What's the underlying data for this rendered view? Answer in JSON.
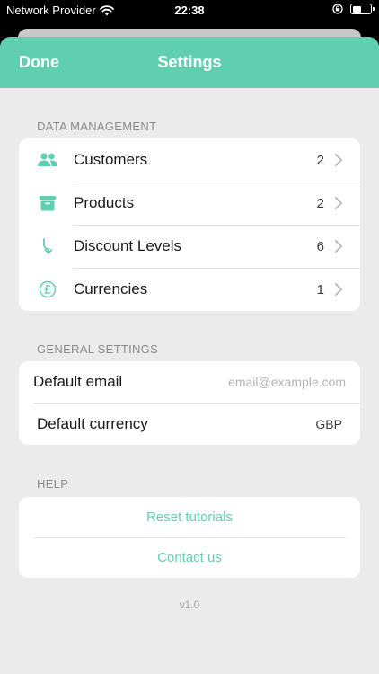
{
  "status": {
    "carrier": "Network Provider",
    "time": "22:38"
  },
  "nav": {
    "done_label": "Done",
    "title": "Settings"
  },
  "data_management": {
    "header": "DATA MANAGEMENT",
    "items": [
      {
        "label": "Customers",
        "count": "2",
        "icon": "people-icon"
      },
      {
        "label": "Products",
        "count": "2",
        "icon": "archive-box-icon"
      },
      {
        "label": "Discount Levels",
        "count": "6",
        "icon": "arrow-down-icon"
      },
      {
        "label": "Currencies",
        "count": "1",
        "icon": "pound-coin-icon"
      }
    ]
  },
  "general_settings": {
    "header": "GENERAL SETTINGS",
    "default_email_label": "Default email",
    "default_email_placeholder": "email@example.com",
    "default_email_value": "",
    "default_currency_label": "Default currency",
    "default_currency_value": "GBP"
  },
  "help": {
    "header": "HELP",
    "reset_tutorials": "Reset tutorials",
    "contact_us": "Contact us"
  },
  "version": "v1.0",
  "colors": {
    "accent": "#5fcfb0",
    "background": "#ebebeb"
  }
}
